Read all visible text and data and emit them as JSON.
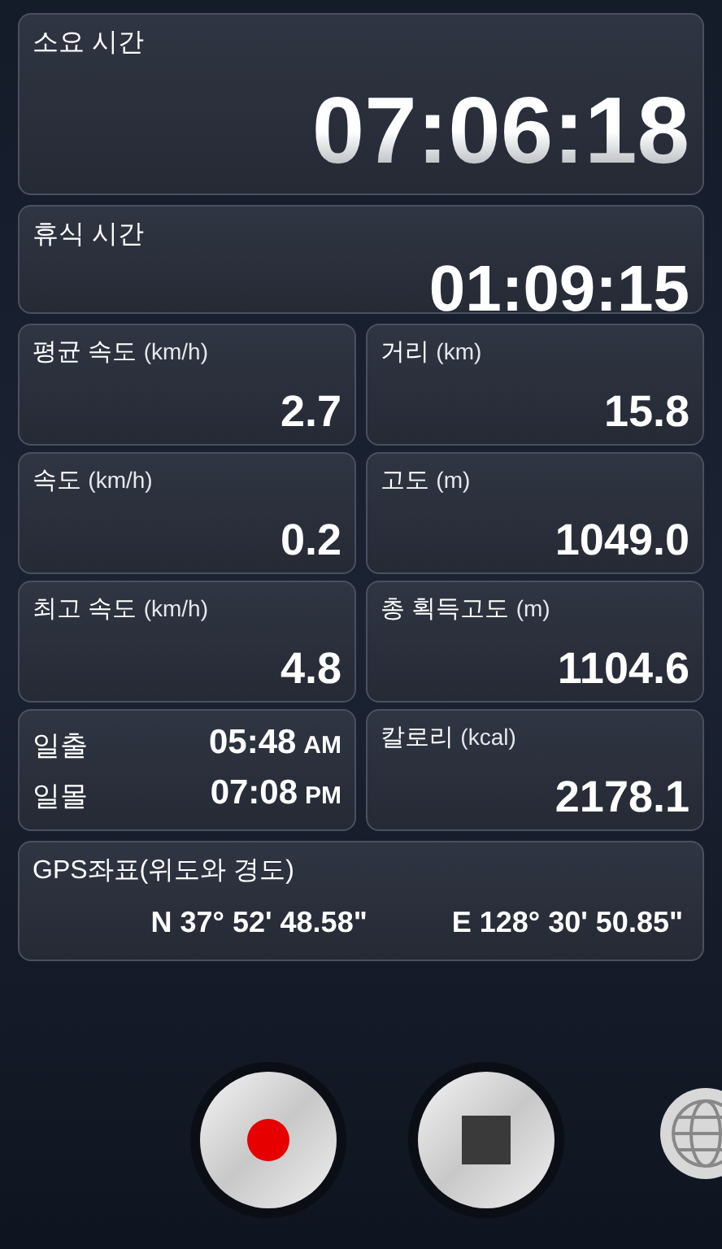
{
  "elapsed": {
    "label": "소요 시간",
    "value": "07:06:18"
  },
  "rest": {
    "label": "휴식 시간",
    "value": "01:09:15"
  },
  "stats": [
    {
      "kind": "value",
      "label": "평균 속도",
      "unit": "(km/h)",
      "value": "2.7"
    },
    {
      "kind": "value",
      "label": "거리",
      "unit": "(km)",
      "value": "15.8"
    },
    {
      "kind": "value",
      "label": "속도",
      "unit": "(km/h)",
      "value": "0.2"
    },
    {
      "kind": "value",
      "label": "고도",
      "unit": "(m)",
      "value": "1049.0"
    },
    {
      "kind": "value",
      "label": "최고 속도",
      "unit": "(km/h)",
      "value": "4.8"
    },
    {
      "kind": "value",
      "label": "총 획득고도",
      "unit": "(m)",
      "value": "1104.6"
    },
    {
      "kind": "sun",
      "rows": [
        {
          "label": "일출",
          "time": "05:48",
          "ampm": "AM"
        },
        {
          "label": "일몰",
          "time": "07:08",
          "ampm": "PM"
        }
      ]
    },
    {
      "kind": "value",
      "label": "칼로리",
      "unit": "(kcal)",
      "value": "2178.1"
    }
  ],
  "gps": {
    "label": "GPS좌표(위도와 경도)",
    "latitude": "N 37° 52' 48.58\"",
    "longitude": "E 128° 30' 50.85\""
  }
}
